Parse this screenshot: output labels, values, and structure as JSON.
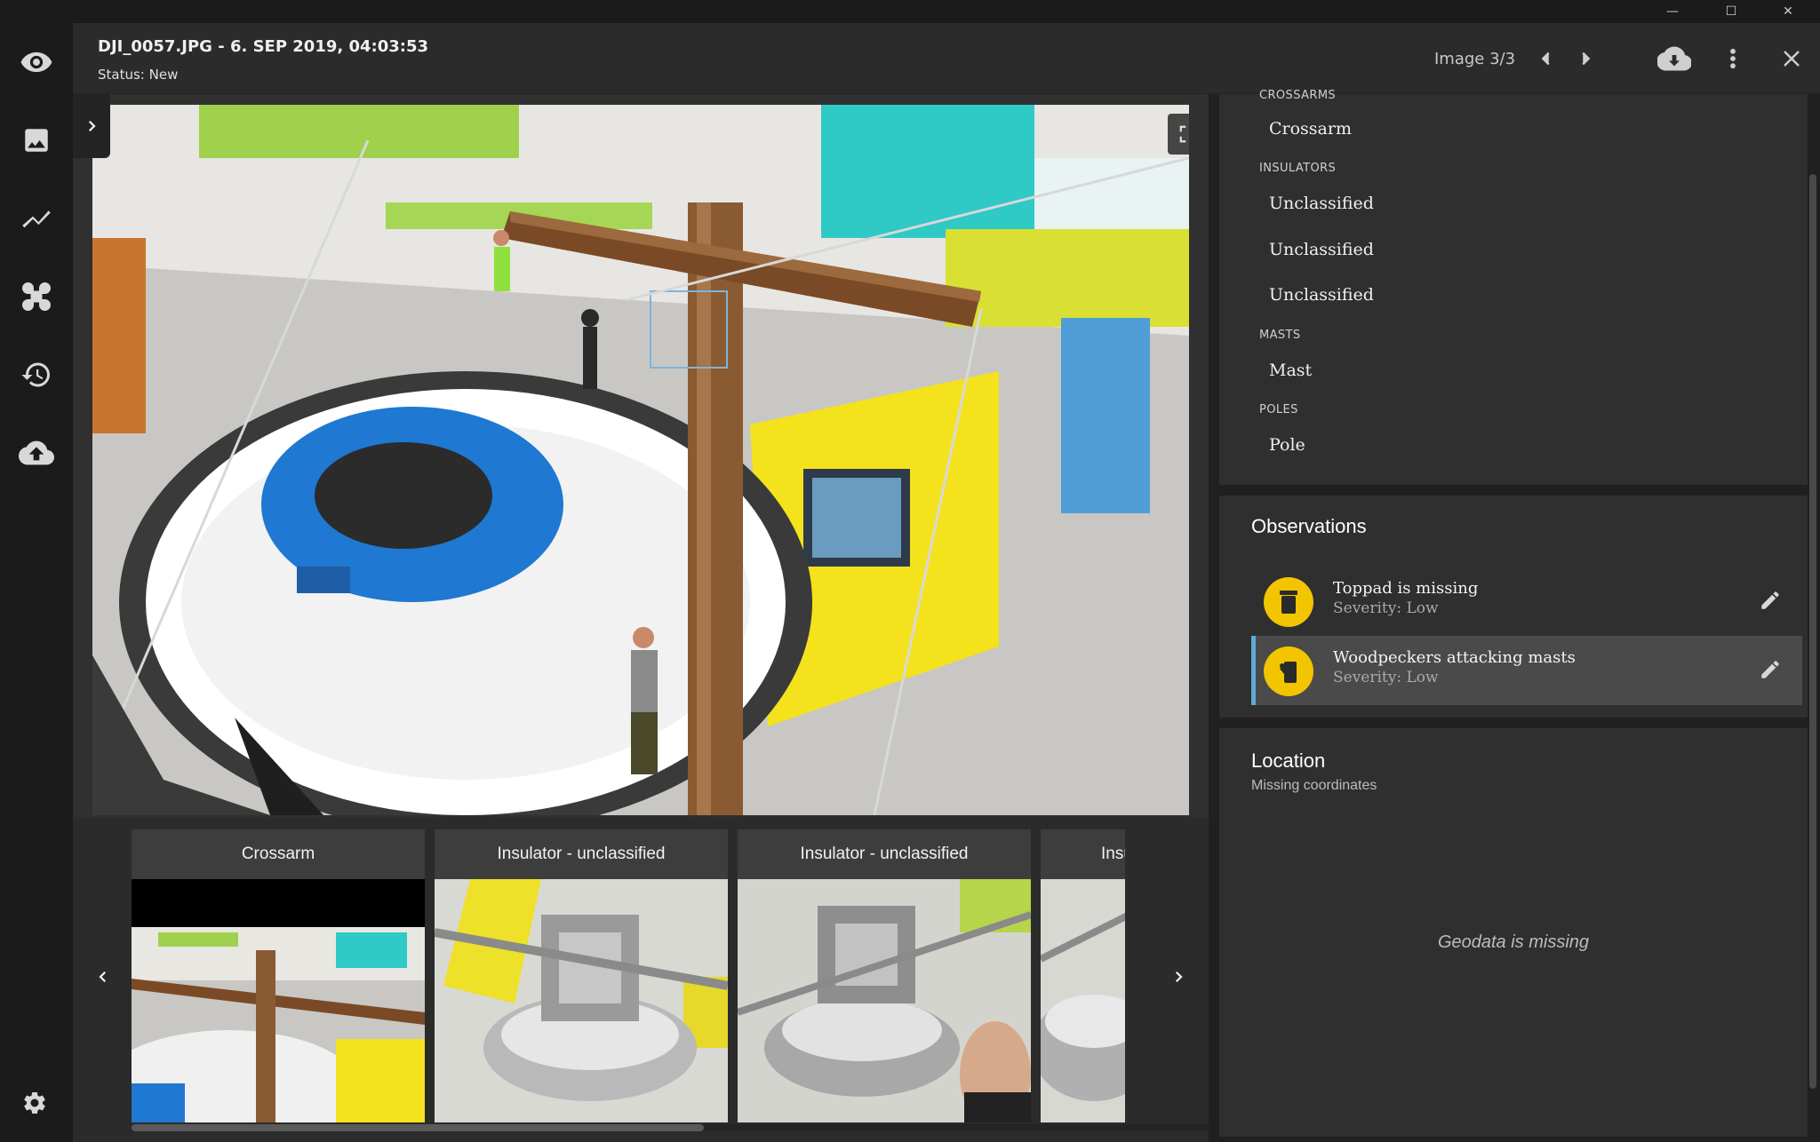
{
  "window": {
    "minimize": "—",
    "maximize": "☐",
    "close": "✕"
  },
  "nav": {
    "items": [
      {
        "icon": "eye-icon"
      },
      {
        "icon": "image-icon"
      },
      {
        "icon": "chart-line-icon"
      },
      {
        "icon": "command-icon"
      },
      {
        "icon": "history-icon"
      },
      {
        "icon": "cloud-upload-icon"
      }
    ],
    "settings_icon": "gear-icon"
  },
  "header": {
    "title": "DJI_0057.JPG - 6. SEP 2019, 04:03:53",
    "status": "Status: New",
    "counter": "Image 3/3"
  },
  "filmstrip": {
    "thumbnails": [
      {
        "label": "Crossarm"
      },
      {
        "label": "Insulator - unclassified"
      },
      {
        "label": "Insulator - unclassified"
      },
      {
        "label": "Insulator - unclassified"
      }
    ],
    "scroll_position_fraction": 0.52
  },
  "components": {
    "top_label": "CROSSARMS",
    "groups": [
      {
        "label": "",
        "items": [
          "Crossarm"
        ]
      },
      {
        "label": "INSULATORS",
        "items": [
          "Unclassified",
          "Unclassified",
          "Unclassified"
        ]
      },
      {
        "label": "MASTS",
        "items": [
          "Mast"
        ]
      },
      {
        "label": "POLES",
        "items": [
          "Pole"
        ]
      }
    ]
  },
  "observations": {
    "title": "Observations",
    "items": [
      {
        "title": "Toppad is missing",
        "severity": "Severity: Low",
        "icon": "toppad-icon",
        "selected": false
      },
      {
        "title": "Woodpeckers attacking masts",
        "severity": "Severity: Low",
        "icon": "woodpecker-icon",
        "selected": true
      }
    ]
  },
  "location": {
    "title": "Location",
    "subtitle": "Missing coordinates",
    "geodata_missing": "Geodata is missing"
  },
  "colors": {
    "accent": "#5fa9d9",
    "severity_badge": "#f2c500",
    "panel": "#2f2f2f",
    "background": "#1a1a1a"
  }
}
